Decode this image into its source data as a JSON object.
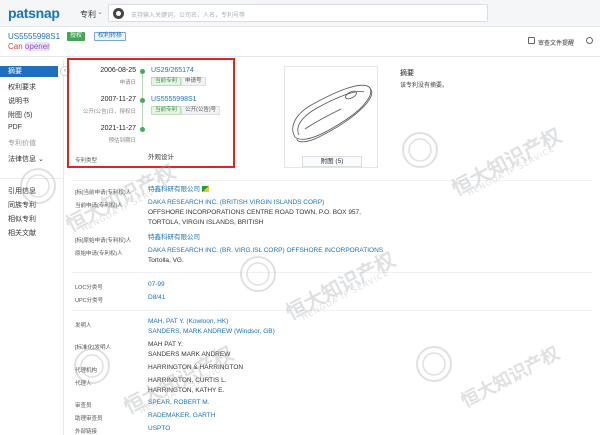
{
  "header": {
    "logo": "patsnap",
    "product": "专利",
    "product_chevron": "⌄",
    "search_placeholder": "支持输入关键词，公司名，人名，专利号等"
  },
  "patent": {
    "number": "US5555998S1",
    "status_badge": "授权",
    "rights_badge": "权利转移",
    "title_word1": "Can",
    "title_word2": "opener"
  },
  "toolbar": {
    "subscribe": "审查文件提醒"
  },
  "sidebar": {
    "collapse": "‹",
    "items": [
      {
        "label": "摘要"
      },
      {
        "label": "权利要求"
      },
      {
        "label": "说明书"
      },
      {
        "label": "附图 (5)"
      },
      {
        "label": "PDF"
      },
      {
        "label": "专利价值"
      },
      {
        "label": "法律信息 ⌄"
      },
      {
        "label": "引用信息"
      },
      {
        "label": "同族专利"
      },
      {
        "label": "相似专利"
      },
      {
        "label": "相关文献"
      }
    ]
  },
  "timeline": [
    {
      "date": "2006-08-25",
      "label": "申请日",
      "link": "US29/265174",
      "tags": [
        "当前专利",
        "申请号"
      ]
    },
    {
      "date": "2007-11-27",
      "label": "公开(公告)日，授权日",
      "link": "US5555998S1",
      "tags": [
        "当前专利",
        "公开(公告)号"
      ]
    },
    {
      "date": "2021-11-27",
      "label": "预估到期日",
      "link": "",
      "tags": []
    }
  ],
  "patent_type": {
    "label": "专利类型",
    "value": "外观设计"
  },
  "drawings": {
    "caption": "附图 (5)"
  },
  "abstract": {
    "title": "摘要",
    "text": "该专利没有摘要。"
  },
  "fields": [
    {
      "label": "[标]当前申请(专利权)人",
      "lines": [
        "特鑫科研有限公司"
      ],
      "link": true,
      "flag": true
    },
    {
      "label": "当前申请(专利权)人",
      "lines": [
        "DAKA RESEARCH INC. (BRITISH VIRGIN ISLANDS CORP)",
        "OFFSHORE INCORPORATIONS CENTRE ROAD TOWN, P.O. BOX 957,",
        "TORTOLA, VIRGIN ISLANDS, BRITISH"
      ],
      "link": false
    },
    {
      "label": "[标]原始申请(专利权)人",
      "lines": [
        "特鑫科研有限公司"
      ],
      "link": true
    },
    {
      "label": "原始申请(专利权)人",
      "lines": [
        "DAKA RESEARCH INC. (BR. VIRG.ISL CORP) OFFSHORE INCORPORATIONS",
        "Tortolla, VG."
      ],
      "link": false
    },
    {
      "label": "LOC分类号",
      "lines": [
        "07-99"
      ],
      "link": true
    },
    {
      "label": "UPC分类号",
      "lines": [
        "D8/41"
      ],
      "link": true
    },
    {
      "label": "发明人",
      "lines": [
        "MAH, PAT Y. (Kowloon, HK)",
        "SANDERS, MARK ANDREW (Windsor, GB)"
      ],
      "link": false
    },
    {
      "label": "[标准化]发明人",
      "lines": [
        "MAH PAT Y.",
        "SANDERS MARK ANDREW"
      ],
      "link": false
    },
    {
      "label": "代理机构",
      "lines": [
        "HARRINGTON & HARRINGTON"
      ],
      "link": false
    },
    {
      "label": "代理人",
      "lines": [
        "HARRINGTON, CURTIS L.",
        "HARRINGTON, KATHY E."
      ],
      "link": false
    },
    {
      "label": "审查员",
      "lines": [
        "SPEAR, ROBERT M."
      ],
      "link": true
    },
    {
      "label": "助理审查员",
      "lines": [
        "RADEMAKER, GARTH"
      ],
      "link": true
    },
    {
      "label": "外部链接",
      "lines": [
        "USPTO"
      ],
      "link": true
    }
  ],
  "watermark": {
    "text": "恒大知识产权",
    "sub": "HENGDA IP SERVICE"
  }
}
